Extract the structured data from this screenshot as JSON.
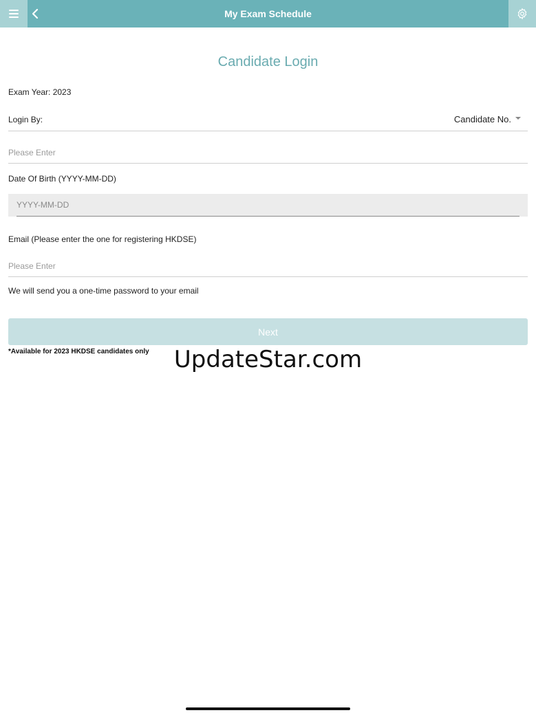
{
  "header": {
    "title": "My Exam Schedule",
    "menu_icon": "hamburger-menu-icon",
    "back_icon": "chevron-left-icon",
    "settings_icon": "gear-icon",
    "color": "#6ab2b8",
    "button_color": "#a7d2d4"
  },
  "form": {
    "heading": "Candidate Login",
    "exam_year": "Exam Year: 2023",
    "login_by_label": "Login By:",
    "login_by_value": "Candidate No.",
    "candidate_no_placeholder": "Please Enter",
    "dob_label": "Date Of Birth (YYYY-MM-DD)",
    "dob_placeholder": "YYYY-MM-DD",
    "email_label": "Email (Please enter the one for registering HKDSE)",
    "email_placeholder": "Please Enter",
    "otp_note": "We will send you a one-time password to your email",
    "next_label": "Next",
    "availability_note": "*Available for 2023 HKDSE candidates only"
  },
  "watermark": "UpdateStar.com"
}
